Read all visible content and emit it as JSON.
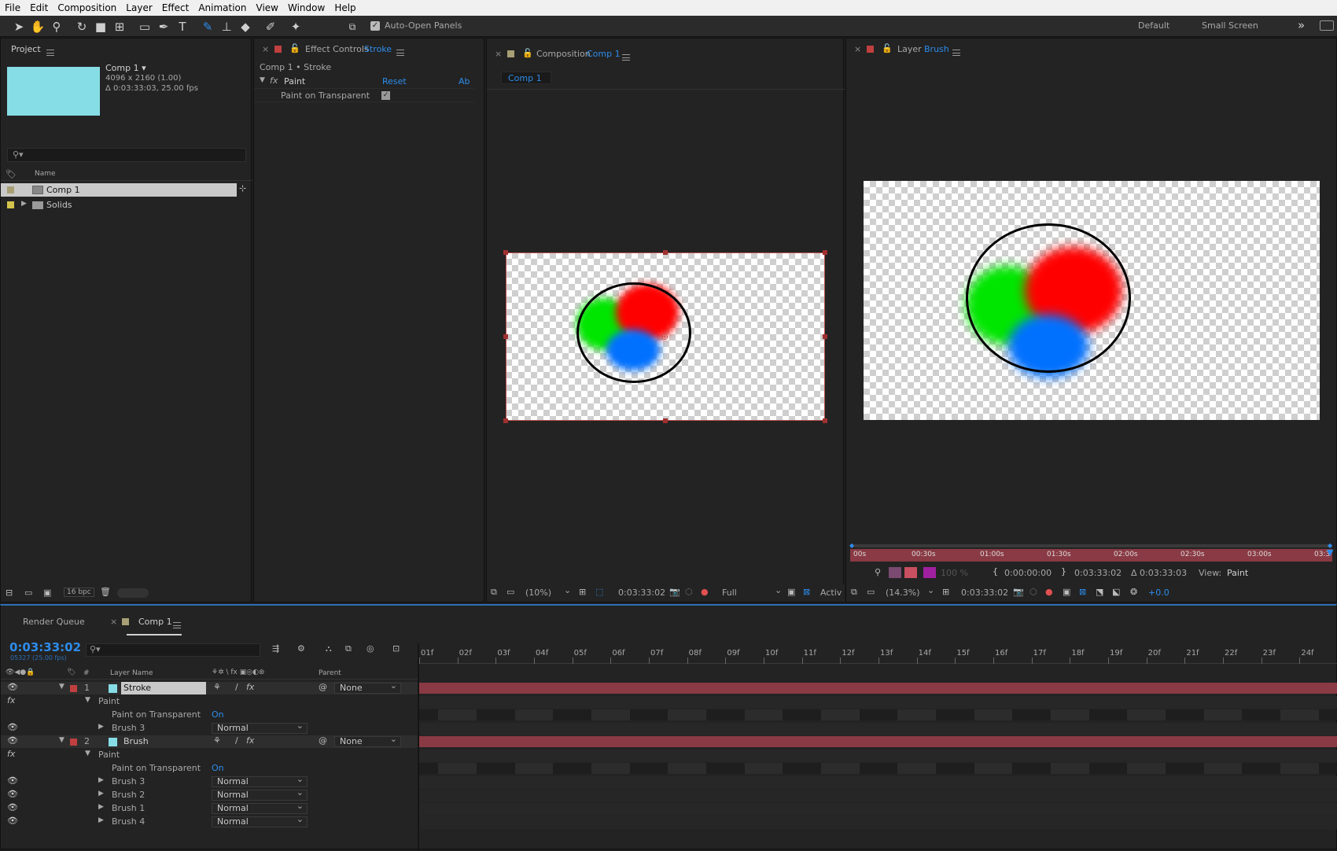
{
  "menu": [
    "File",
    "Edit",
    "Composition",
    "Layer",
    "Effect",
    "Animation",
    "View",
    "Window",
    "Help"
  ],
  "toolbar": {
    "auto_open_label": "Auto-Open Panels",
    "auto_open_checked": true,
    "workspaces": [
      "Default",
      "Small Screen"
    ],
    "more": "»"
  },
  "project": {
    "title": "Project",
    "comp_name": "Comp 1 ▾",
    "comp_size": "4096 x 2160 (1.00)",
    "comp_duration": "Δ 0:03:33:03, 25.00 fps",
    "thumb_color": "#86dde6",
    "column_name": "Name",
    "items": [
      {
        "name": "Comp 1",
        "label_color": "#a89f75"
      },
      {
        "name": "Solids",
        "label_color": "#d4c34a"
      }
    ],
    "bpc": "16 bpc"
  },
  "effect_controls": {
    "title": "Effect Controls",
    "layer": "Stroke",
    "breadcrumb": "Comp 1 • Stroke",
    "effect_name": "Paint",
    "reset": "Reset",
    "about": "Ab",
    "param_label": "Paint on Transparent",
    "param_checked": true
  },
  "composition": {
    "title": "Composition",
    "name": "Comp 1",
    "tab": "Comp 1",
    "zoom": "(10%)",
    "timecode": "0:03:33:02",
    "resolution": "Full",
    "active": "Activ"
  },
  "layer_panel": {
    "title": "Layer",
    "name": "Brush",
    "ruler_labels": [
      "00s",
      "00:30s",
      "01:00s",
      "01:30s",
      "02:00s",
      "02:30s",
      "03:00s",
      "03:3"
    ],
    "opacity": "100 %",
    "in_point": "0:00:00:00",
    "out_point": "0:03:33:02",
    "duration": "Δ 0:03:33:03",
    "view_label": "View:",
    "view_value": "Paint",
    "zoom": "(14.3%)",
    "timecode": "0:03:33:02",
    "exposure": "+0.0"
  },
  "timeline": {
    "render_queue": "Render Queue",
    "comp_tab": "Comp 1",
    "timecode": "0:03:33:02",
    "frame_info": "05327 (25.00 fps)",
    "col_layer_name": "Layer Name",
    "col_parent": "Parent",
    "col_num": "#",
    "ruler": [
      "01f",
      "02f",
      "03f",
      "04f",
      "05f",
      "06f",
      "07f",
      "08f",
      "09f",
      "10f",
      "11f",
      "12f",
      "13f",
      "14f",
      "15f",
      "16f",
      "17f",
      "18f",
      "19f",
      "20f",
      "21f",
      "22f",
      "23f",
      "24f"
    ],
    "layer1": {
      "num": "1",
      "name": "Stroke",
      "parent": "None",
      "color": "#86dde6"
    },
    "layer2": {
      "num": "2",
      "name": "Brush",
      "parent": "None",
      "color": "#86dde6"
    },
    "paint_label": "Paint",
    "pot_label": "Paint on Transparent",
    "pot_value": "On",
    "brushes1": [
      {
        "name": "Brush 3",
        "mode": "Normal"
      }
    ],
    "brushes2": [
      {
        "name": "Brush 3",
        "mode": "Normal"
      },
      {
        "name": "Brush 2",
        "mode": "Normal"
      },
      {
        "name": "Brush 1",
        "mode": "Normal"
      },
      {
        "name": "Brush 4",
        "mode": "Normal"
      }
    ]
  },
  "colors": {
    "accent": "#2d8ceb",
    "track_bar": "#8a3a44",
    "label_red": "#c0403f",
    "ui_bg": "#232323"
  }
}
